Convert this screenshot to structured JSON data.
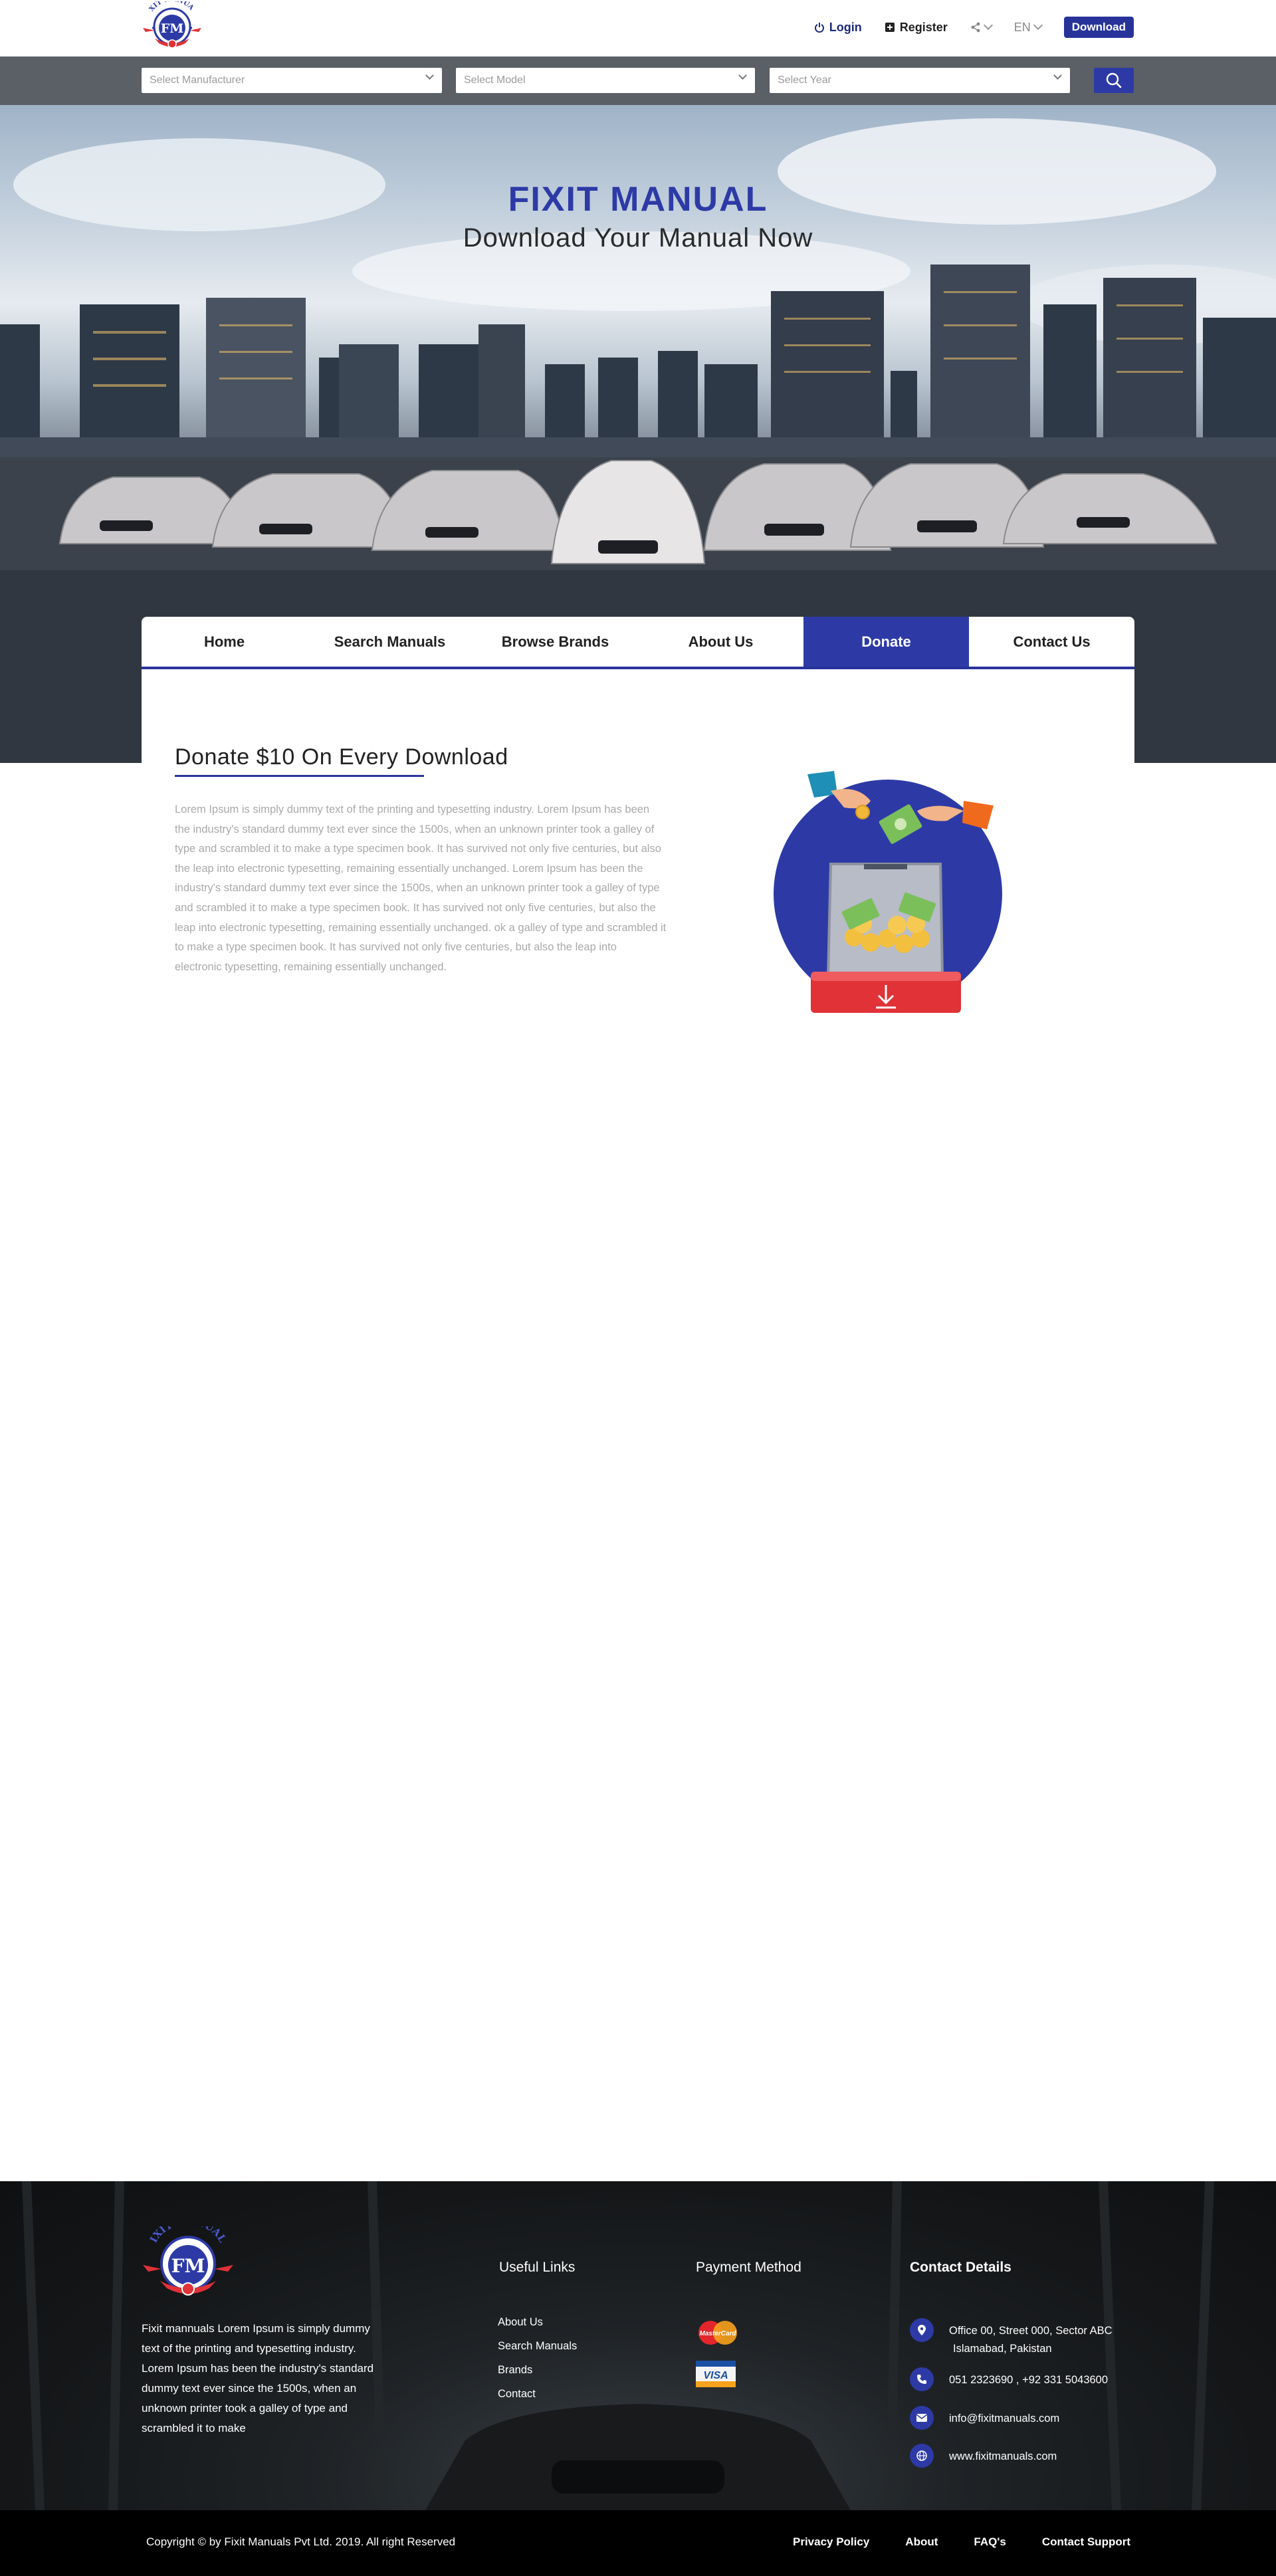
{
  "header": {
    "logo_text": "FIXIT MANUALS",
    "logo_initials": "FM",
    "login_label": "Login",
    "register_label": "Register",
    "language": "EN",
    "download_label": "Download"
  },
  "search": {
    "manufacturer_placeholder": "Select Manufacturer",
    "model_placeholder": "Select Model",
    "year_placeholder": "Select Year"
  },
  "hero": {
    "title": "FIXIT MANUAL",
    "subtitle": "Download Your Manual Now"
  },
  "nav": {
    "items": [
      {
        "label": "Home",
        "active": false
      },
      {
        "label": "Search Manuals",
        "active": false
      },
      {
        "label": "Browse Brands",
        "active": false
      },
      {
        "label": "About Us",
        "active": false
      },
      {
        "label": "Donate",
        "active": true
      },
      {
        "label": "Contact Us",
        "active": false
      }
    ]
  },
  "donate": {
    "title": "Donate $10 On Every Download",
    "body": "Lorem Ipsum is simply dummy text of the printing and typesetting industry. Lorem Ipsum has been the industry's standard dummy text ever since the 1500s, when an unknown printer took a galley of type and scrambled it to make a type specimen book. It has survived not only five centuries, but also the leap into electronic typesetting, remaining essentially unchanged. Lorem Ipsum has been the industry's standard dummy text ever since the 1500s, when an unknown printer took a galley of type and scrambled it to make a type specimen book. It has survived not only five centuries, but also the leap into electronic typesetting, remaining essentially unchanged. ok a galley of type and scrambled it to make a type specimen book. It has survived not only five centuries, but also the leap into electronic typesetting, remaining essentially unchanged."
  },
  "footer": {
    "about": "Fixit mannuals Lorem Ipsum is simply dummy text of the printing and typesetting industry. Lorem Ipsum has been the industry's standard dummy text ever since the 1500s, when an unknown printer took a galley of type and scrambled it to make",
    "useful_links_title": "Useful Links",
    "useful_links": [
      "About Us",
      "Search Manuals",
      "Brands",
      "Contact"
    ],
    "payment_title": "Payment Method",
    "payment_methods": [
      "MasterCard",
      "VISA"
    ],
    "contact_title": "Contact Details",
    "address_line1": "Office 00, Street 000, Sector ABC",
    "address_line2": "Islamabad, Pakistan",
    "phone": "051 2323690 , +92 331 5043600",
    "email": "info@fixitmanuals.com",
    "website": "www.fixitmanuals.com",
    "copyright": "Copyright © by Fixit Manuals Pvt Ltd. 2019. All right Reserved",
    "bottom_links": [
      "Privacy Policy",
      "About",
      "FAQ's",
      "Contact Support"
    ]
  },
  "colors": {
    "brand_blue": "#2d3aa6",
    "brand_red": "#e03237",
    "search_bar": "#5b5f66"
  }
}
